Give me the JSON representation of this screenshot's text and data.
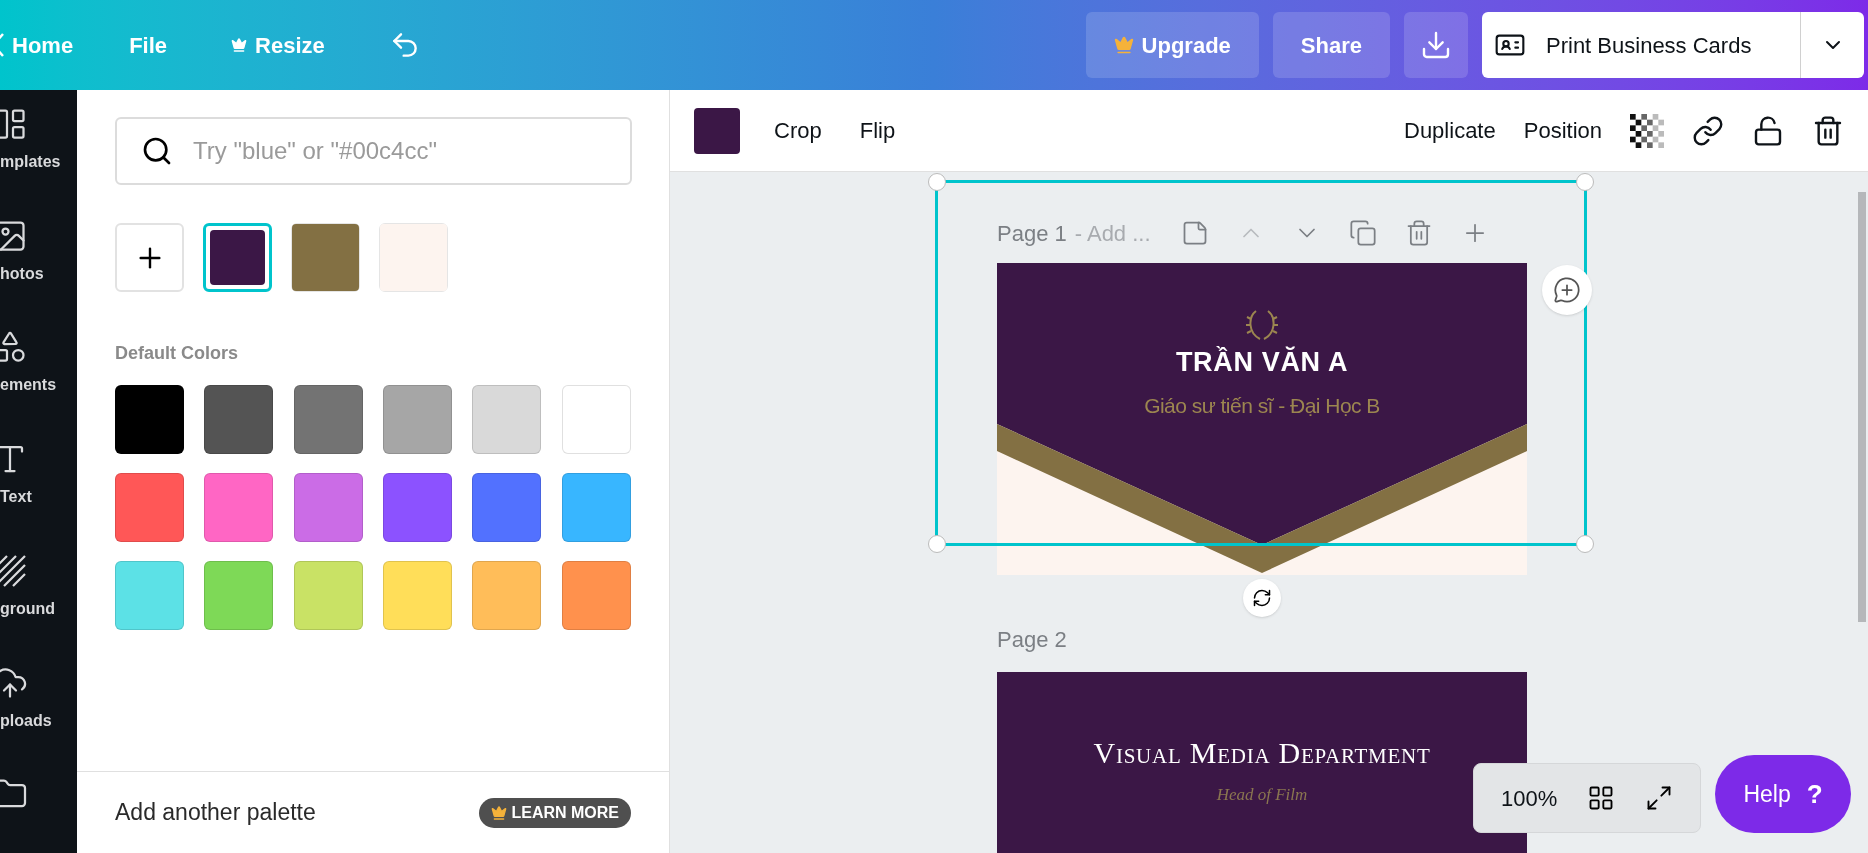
{
  "topbar": {
    "nav": [
      {
        "kind": "back",
        "label": "Home"
      },
      {
        "kind": "plain",
        "label": "File"
      },
      {
        "kind": "crown",
        "label": "Resize"
      }
    ],
    "actions": [
      {
        "kind": "crown",
        "label": "Upgrade"
      },
      {
        "kind": "plain",
        "label": "Share"
      }
    ],
    "print_button": {
      "label": "Print Business Cards"
    }
  },
  "sidebar": {
    "items": [
      {
        "kind": "templates",
        "label": "mplates"
      },
      {
        "kind": "photos",
        "label": "hotos"
      },
      {
        "kind": "elements",
        "label": "ements"
      },
      {
        "kind": "text",
        "label": "Text"
      },
      {
        "kind": "background",
        "label": "ground"
      },
      {
        "kind": "uploads",
        "label": "ploads"
      },
      {
        "kind": "folder"
      }
    ]
  },
  "color_panel": {
    "search": {
      "placeholder": "Try \"blue\" or \"#00c4cc\""
    },
    "document_colors": [
      {
        "color": "#3b1746",
        "selected": true
      },
      {
        "color": "#837043",
        "selected": false
      },
      {
        "color": "#fdf4ef",
        "selected": false
      }
    ],
    "default_heading": "Default Colors",
    "default_colors": [
      {
        "color": "#000000"
      },
      {
        "color": "#545454"
      },
      {
        "color": "#737373"
      },
      {
        "color": "#a6a6a6"
      },
      {
        "color": "#d9d9d9"
      },
      {
        "color": "#ffffff"
      },
      {
        "color": "#ff5757"
      },
      {
        "color": "#ff66c4"
      },
      {
        "color": "#cb6ce6"
      },
      {
        "color": "#8c52ff"
      },
      {
        "color": "#5271ff"
      },
      {
        "color": "#38b6ff"
      },
      {
        "color": "#5ce1e6"
      },
      {
        "color": "#7ed957"
      },
      {
        "color": "#c9e265"
      },
      {
        "color": "#ffde59"
      },
      {
        "color": "#ffbd59"
      },
      {
        "color": "#ff914d"
      }
    ],
    "footer": {
      "label": "Add another palette",
      "badge": "LEARN MORE"
    }
  },
  "toolbar": {
    "swatch": {
      "color": "#3b1746"
    },
    "left_buttons": [
      "Crop",
      "Flip"
    ],
    "right_buttons": [
      "Duplicate",
      "Position"
    ]
  },
  "pages": [
    {
      "label": "Page 1",
      "title_hint": "- Add ...",
      "name": "TRẦN VĂN A",
      "subtitle": "Giáo sư tiến sĩ - Đại Học B"
    },
    {
      "label": "Page 2",
      "name": "Visual Media Department",
      "subtitle": "Head of Film"
    }
  ],
  "zoom": {
    "value": "100%"
  },
  "help": {
    "label": "Help",
    "mark": "?"
  }
}
